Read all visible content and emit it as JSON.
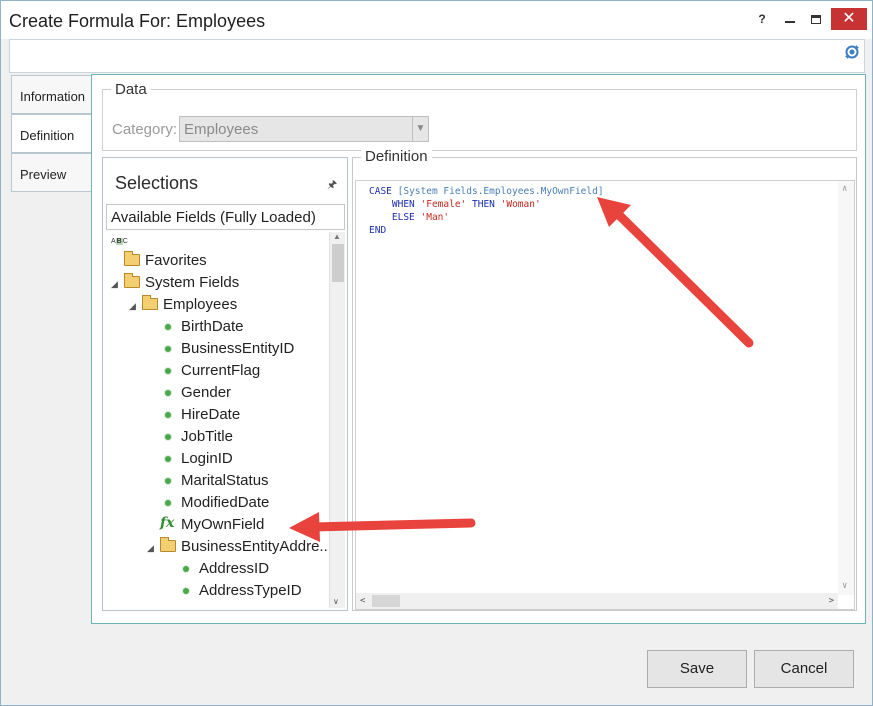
{
  "window": {
    "title": "Create Formula For: Employees",
    "help_label": "?",
    "close_label": "✕"
  },
  "side_tabs": [
    {
      "label": "Information"
    },
    {
      "label": "Definition"
    },
    {
      "label": "Preview"
    }
  ],
  "data_group": {
    "title": "Data",
    "category_label": "Category:",
    "category_value": "Employees"
  },
  "selections": {
    "title": "Selections",
    "header": "Available Fields (Fully Loaded)",
    "tree": [
      {
        "label": "Favorites",
        "type": "folder"
      },
      {
        "label": "System Fields",
        "type": "folder"
      },
      {
        "label": "Employees",
        "type": "folder"
      },
      {
        "label": "BirthDate",
        "type": "field"
      },
      {
        "label": "BusinessEntityID",
        "type": "field"
      },
      {
        "label": "CurrentFlag",
        "type": "field"
      },
      {
        "label": "Gender",
        "type": "field"
      },
      {
        "label": "HireDate",
        "type": "field"
      },
      {
        "label": "JobTitle",
        "type": "field"
      },
      {
        "label": "LoginID",
        "type": "field"
      },
      {
        "label": "MaritalStatus",
        "type": "field"
      },
      {
        "label": "ModifiedDate",
        "type": "field"
      },
      {
        "label": "MyOwnField",
        "type": "formula"
      },
      {
        "label": "BusinessEntityAddre...",
        "type": "folder"
      },
      {
        "label": "AddressID",
        "type": "field"
      },
      {
        "label": "AddressTypeID",
        "type": "field"
      }
    ]
  },
  "definition": {
    "title": "Definition",
    "code": {
      "case_kw": "CASE",
      "field_prefix": "[System Fields.Employees.",
      "field_name": "MyOwnField",
      "field_suffix": "]",
      "when_kw": "WHEN",
      "when_value": "'Female'",
      "then_kw": "THEN",
      "then_value": "'Woman'",
      "else_kw": "ELSE",
      "else_value": "'Man'",
      "end_kw": "END"
    }
  },
  "buttons": {
    "save": "Save",
    "cancel": "Cancel"
  },
  "colors": {
    "keyword": "#1a2fb0",
    "string": "#c8281e",
    "field": "#4a7fb5",
    "arrow": "#e8433c",
    "close": "#c73333"
  }
}
